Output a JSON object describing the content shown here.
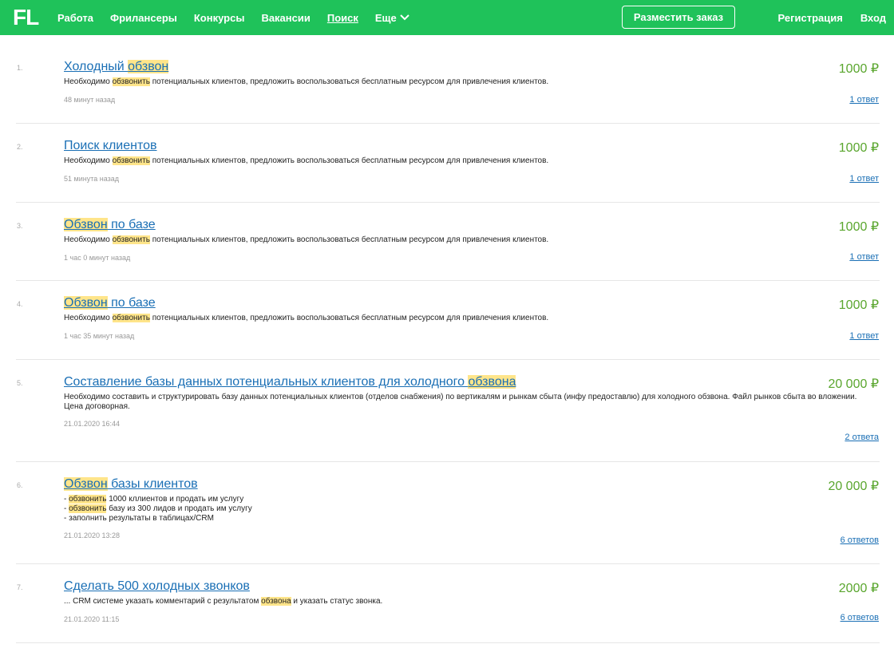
{
  "header": {
    "logo": "FL",
    "nav": [
      "Работа",
      "Фрилансеры",
      "Конкурсы",
      "Вакансии",
      "Поиск",
      "Еще"
    ],
    "post_button": "Разместить заказ",
    "register": "Регистрация",
    "login": "Вход",
    "colors": {
      "bar": "#1fc25a"
    }
  },
  "items": [
    {
      "num": "1.",
      "title_parts": [
        "Холодный ",
        "обзвон",
        ""
      ],
      "price": "1000 ₽",
      "desc_parts": [
        "Необходимо ",
        "обзвонить",
        " потенциальных клиентов, предложить воспользоваться бесплатным ресурсом для привлечения клиентов."
      ],
      "time": "48 минут назад",
      "answers": "1 ответ"
    },
    {
      "num": "2.",
      "title": "Поиск клиентов",
      "price": "1000 ₽",
      "desc_parts": [
        "Необходимо ",
        "обзвонить",
        " потенциальных клиентов, предложить воспользоваться бесплатным ресурсом для привлечения клиентов."
      ],
      "time": "51 минута назад",
      "answers": "1 ответ"
    },
    {
      "num": "3.",
      "title_parts": [
        "",
        "Обзвон",
        " по базе"
      ],
      "price": "1000 ₽",
      "desc_parts": [
        "Необходимо ",
        "обзвонить",
        " потенциальных клиентов, предложить воспользоваться бесплатным ресурсом для привлечения клиентов."
      ],
      "time": "1 час 0 минут назад",
      "answers": "1 ответ"
    },
    {
      "num": "4.",
      "title_parts": [
        "",
        "Обзвон",
        " по базе"
      ],
      "price": "1000 ₽",
      "desc_parts": [
        "Необходимо ",
        "обзвонить",
        " потенциальных клиентов, предложить воспользоваться бесплатным ресурсом для привлечения клиентов."
      ],
      "time": "1 час 35 минут назад",
      "answers": "1 ответ"
    },
    {
      "num": "5.",
      "title_parts": [
        "Составление базы данных потенциальных клиентов для холодного ",
        "обзвона",
        ""
      ],
      "price": "20 000 ₽",
      "desc_lines": [
        "Необходимо составить и структурировать базу данных потенциальных клиентов (отделов снабжения) по вертикалям и рынкам сбыта (инфу предоставлю) для холодного обзвона. Файл рынков сбыта во вложении.",
        "Цена договорная."
      ],
      "time": "21.01.2020 16:44",
      "answers": "2 ответа"
    },
    {
      "num": "6.",
      "title_parts": [
        "",
        "Обзвон",
        " базы клиентов"
      ],
      "price": "20 000 ₽",
      "desc_hl_lines": [
        [
          "- ",
          "обзвонить",
          " 1000 кллиентов и продать им услугу"
        ],
        [
          "- ",
          "обзвонить",
          " базу из 300 лидов и продать им услугу"
        ],
        [
          "- заполнить результаты в таблицах/CRM",
          "",
          ""
        ]
      ],
      "time": "21.01.2020 13:28",
      "answers": "6 ответов"
    },
    {
      "num": "7.",
      "title": "Сделать 500 холодных звонков",
      "price": "2000 ₽",
      "desc_parts": [
        "... CRM системе указать комментарий с результатом ",
        "обзвона",
        " и указать статус звонка."
      ],
      "time": "21.01.2020 11:15",
      "answers": "6 ответов"
    }
  ]
}
